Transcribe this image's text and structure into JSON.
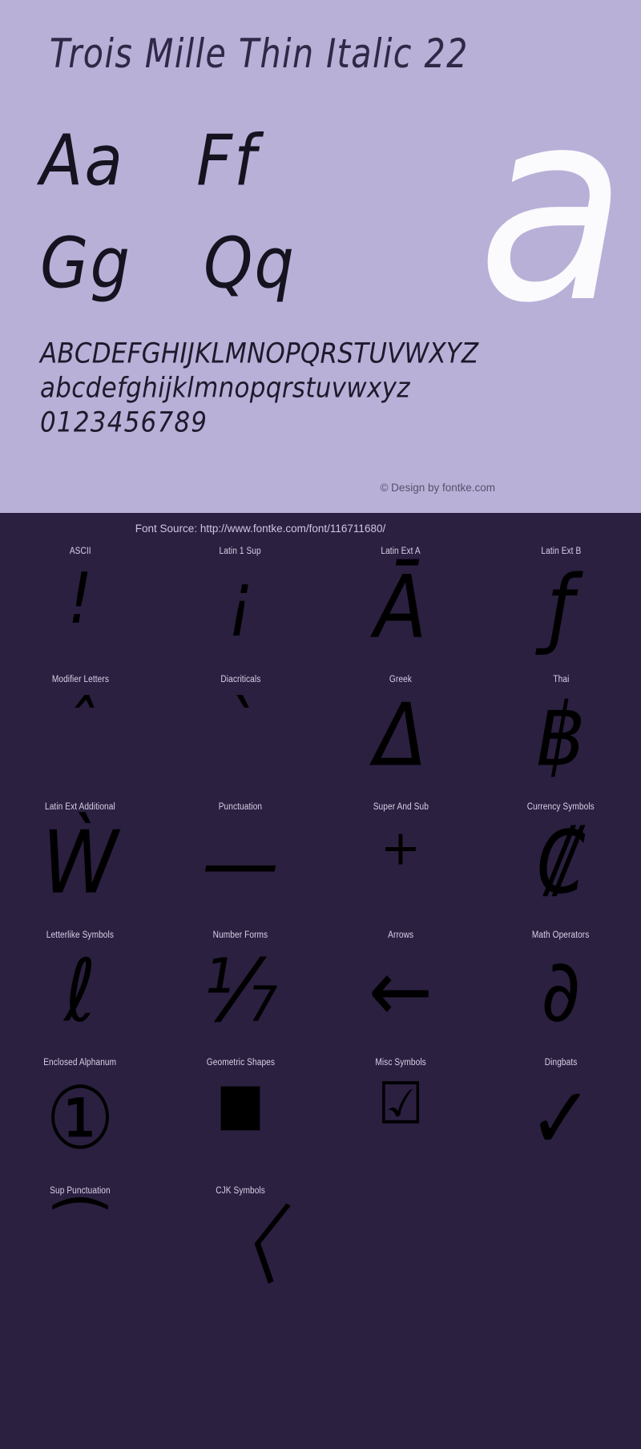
{
  "specimen": {
    "title": "Trois Mille Thin Italic 22",
    "watermark_glyph": "a",
    "pairs": [
      [
        "Aa",
        "Ff"
      ],
      [
        "Gg",
        "Qq"
      ]
    ],
    "alphabet_upper": "ABCDEFGHIJKLMNOPQRSTUVWXYZ",
    "alphabet_lower": "abcdefghijklmnopqrstuvwxyz",
    "digits": "0123456789",
    "credit": "© Design by fontke.com"
  },
  "blocks": {
    "source": "Font Source: http://www.fontke.com/font/116711680/",
    "items": [
      {
        "label": "ASCII",
        "glyph": "!",
        "size": "normal"
      },
      {
        "label": "Latin 1 Sup",
        "glyph": "¡",
        "size": "normal"
      },
      {
        "label": "Latin Ext A",
        "glyph": "Ā",
        "size": "big"
      },
      {
        "label": "Latin Ext B",
        "glyph": "ƒ",
        "size": "big"
      },
      {
        "label": "Modifier Letters",
        "glyph": "ˆ",
        "size": "normal"
      },
      {
        "label": "Diacriticals",
        "glyph": "ˋ",
        "size": "normal"
      },
      {
        "label": "Greek",
        "glyph": "Δ",
        "size": "big"
      },
      {
        "label": "Thai",
        "glyph": "฿",
        "size": "big"
      },
      {
        "label": "Latin Ext Additional",
        "glyph": "Ẁ",
        "size": "big"
      },
      {
        "label": "Punctuation",
        "glyph": "—",
        "size": "big"
      },
      {
        "label": "Super And Sub",
        "glyph": "⁺",
        "size": "big"
      },
      {
        "label": "Currency Symbols",
        "glyph": "₡",
        "size": "big"
      },
      {
        "label": "Letterlike Symbols",
        "glyph": "ℓ",
        "size": "big"
      },
      {
        "label": "Number Forms",
        "glyph": "⅐",
        "size": "big"
      },
      {
        "label": "Arrows",
        "glyph": "←",
        "size": "big"
      },
      {
        "label": "Math Operators",
        "glyph": "∂",
        "size": "big"
      },
      {
        "label": "Enclosed Alphanum",
        "glyph": "①",
        "size": "big"
      },
      {
        "label": "Geometric Shapes",
        "glyph": "■",
        "size": "wide"
      },
      {
        "label": "Misc Symbols",
        "glyph": "☑",
        "size": "wide"
      },
      {
        "label": "Dingbats",
        "glyph": "✓",
        "size": "big"
      },
      {
        "label": "Sup Punctuation",
        "glyph": "⁀",
        "size": "normal"
      },
      {
        "label": "CJK Symbols",
        "glyph": "〈",
        "size": "big"
      },
      {
        "label": "",
        "glyph": "",
        "size": "normal"
      },
      {
        "label": "",
        "glyph": "",
        "size": "normal"
      }
    ]
  },
  "colors": {
    "specimen_background": "#b9b0d8",
    "blocks_background": "#2b2040",
    "glyph": "#15131f",
    "watermark": "#ffffff",
    "label": "#d8d1e8"
  }
}
